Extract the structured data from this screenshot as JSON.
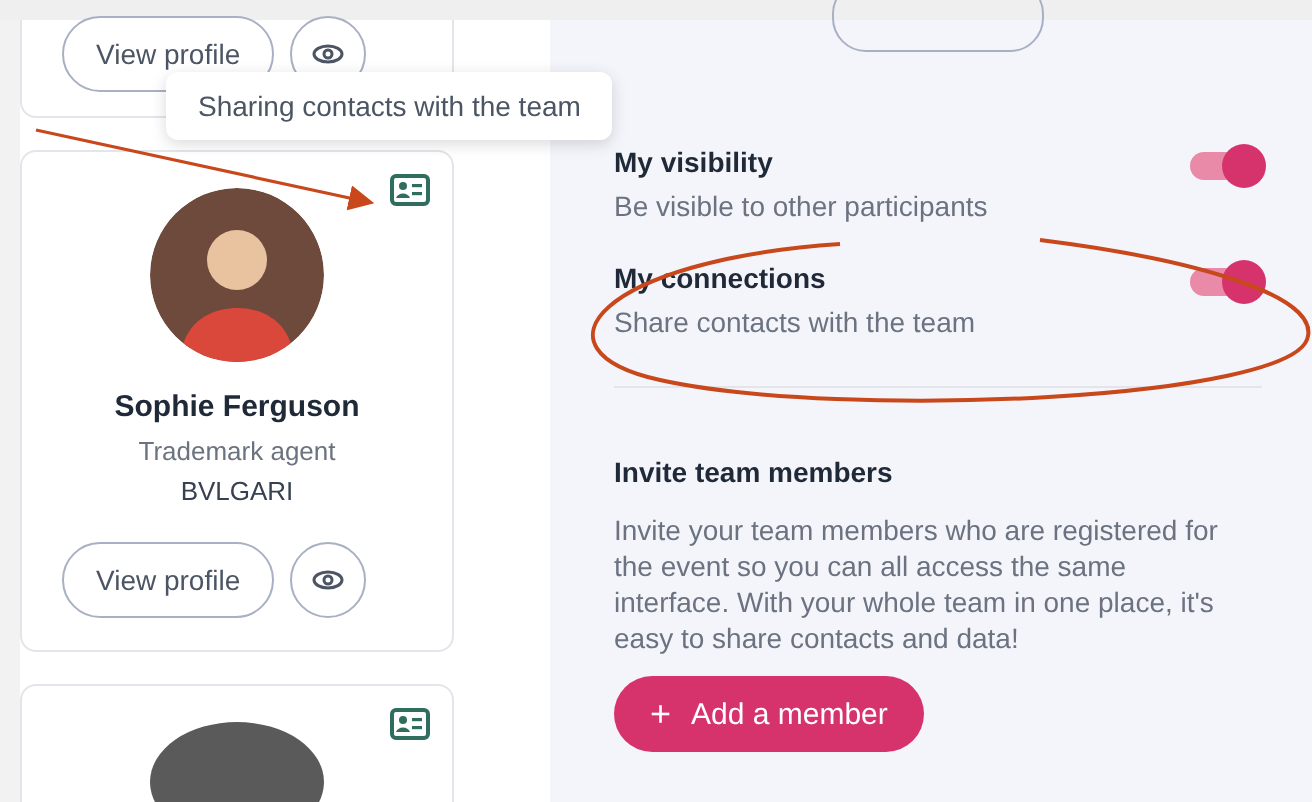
{
  "contacts": [
    {
      "kind": "partial",
      "view_button": "View profile"
    },
    {
      "kind": "full",
      "sharing": true,
      "name": "Sophie Ferguson",
      "job_title": "Trademark agent",
      "company": "BVLGARI",
      "view_button": "View profile"
    },
    {
      "kind": "top",
      "sharing": true
    }
  ],
  "tooltip": {
    "text": "Sharing contacts with the team"
  },
  "settings": [
    {
      "title": "My visibility",
      "description": "Be visible to other participants",
      "on": true
    },
    {
      "title": "My connections",
      "description": "Share contacts with the team",
      "on": true
    }
  ],
  "invite": {
    "title": "Invite team members",
    "text": "Invite your team members who are registered for the event so you can all access the same interface. With your whole team in one place, it's easy to share contacts and data!",
    "button_icon": "+",
    "button": "Add a member"
  }
}
